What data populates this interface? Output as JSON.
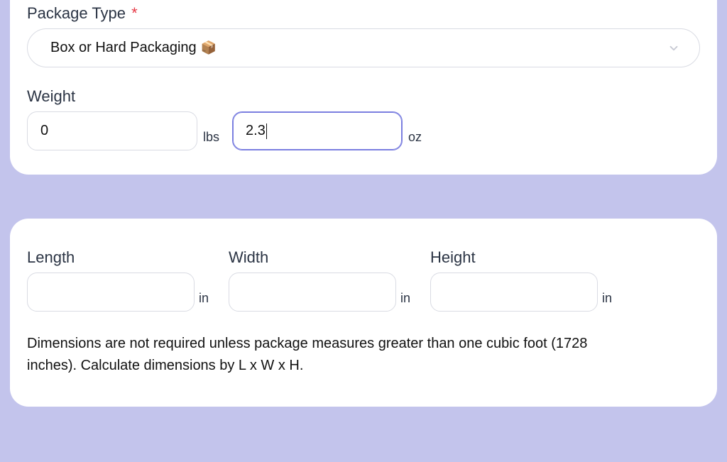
{
  "packageType": {
    "label": "Package Type",
    "required": "*",
    "selected": "Box or Hard Packaging",
    "emoji": "📦"
  },
  "weight": {
    "label": "Weight",
    "lbs_value": "0",
    "lbs_unit": "lbs",
    "oz_value": "2.3",
    "oz_unit": "oz"
  },
  "dimensions": {
    "length_label": "Length",
    "width_label": "Width",
    "height_label": "Height",
    "unit_in": "in",
    "hint": "Dimensions are not required unless package measures greater than one cubic foot (1728 inches). Calculate dimensions by L x W x H."
  }
}
